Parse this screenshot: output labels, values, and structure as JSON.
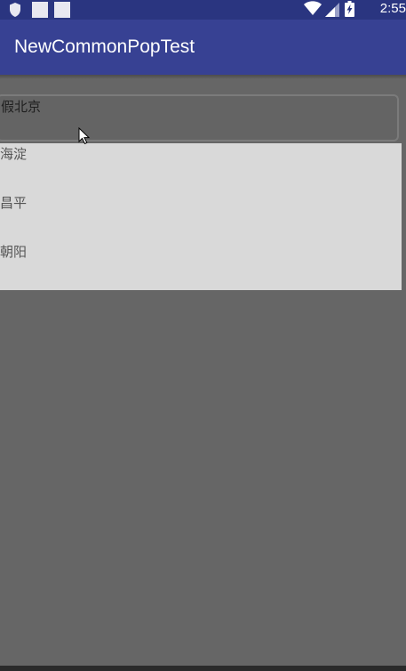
{
  "status_bar": {
    "time": "2:55",
    "icons": [
      "shield-icon",
      "notification-square-icon",
      "notification-square-icon",
      "wifi-icon",
      "cell-signal-icon",
      "battery-charging-icon"
    ]
  },
  "app_bar": {
    "title": "NewCommonPopTest"
  },
  "spinner": {
    "selected_label": "假北京"
  },
  "dropdown": {
    "items": [
      {
        "label": "海淀"
      },
      {
        "label": "昌平"
      },
      {
        "label": "朝阳"
      }
    ]
  },
  "colors": {
    "status_bar": "#2a3580",
    "app_bar": "#374193",
    "dim_background": "#666666",
    "dropdown_background": "#d9d9d9"
  }
}
